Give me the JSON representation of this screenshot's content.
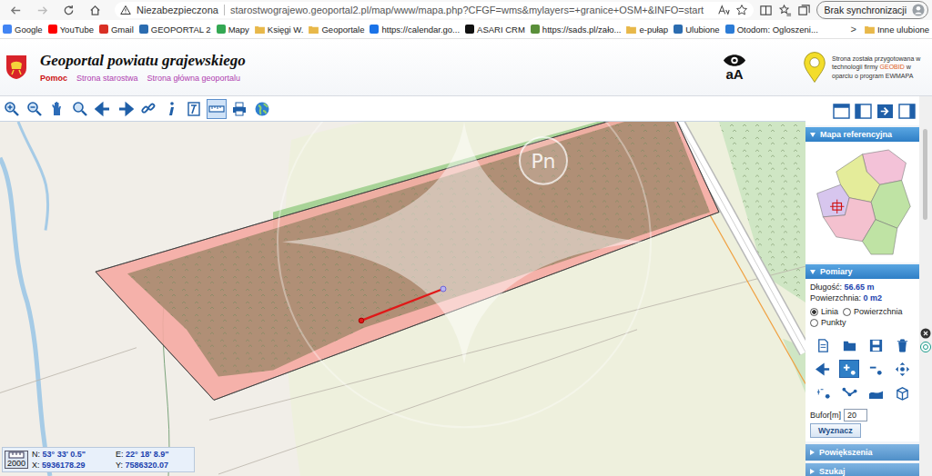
{
  "browser": {
    "security": "Niezabezpieczona",
    "url": "starostwograjewo.geoportal2.pl/map/www/mapa.php?CFGF=wms&mylayers=+granice+OSM+&INFO=start",
    "profile": "Brak synchronizacji"
  },
  "bookmarks": [
    {
      "label": "Google",
      "kind": "site",
      "color": "#4285f4"
    },
    {
      "label": "YouTube",
      "kind": "site",
      "color": "#ff0000"
    },
    {
      "label": "Gmail",
      "kind": "site",
      "color": "#d93025"
    },
    {
      "label": "GEOPORTAL 2",
      "kind": "site",
      "color": "#2b6cb0"
    },
    {
      "label": "Mapy",
      "kind": "site",
      "color": "#34a853"
    },
    {
      "label": "Księgi W.",
      "kind": "folder",
      "color": "#e8b84a"
    },
    {
      "label": "Geoportale",
      "kind": "folder",
      "color": "#e8b84a"
    },
    {
      "label": "https://calendar.go...",
      "kind": "site",
      "color": "#1a73e8"
    },
    {
      "label": "ASARI CRM",
      "kind": "site",
      "color": "#111111"
    },
    {
      "label": "https://sads.pl/zało...",
      "kind": "site",
      "color": "#5a8f3a"
    },
    {
      "label": "e-pułap",
      "kind": "folder",
      "color": "#e8b84a"
    },
    {
      "label": "Ulubione",
      "kind": "site",
      "color": "#2b6cb0"
    },
    {
      "label": "Otodom: Ogloszeni...",
      "kind": "site",
      "color": "#2b7bd6"
    }
  ],
  "bookmarks_more": ">",
  "bookmarks_other": "Inne ulubione",
  "header": {
    "title": "Geoportal powiatu grajewskiego",
    "links": [
      {
        "label": "Pomoc",
        "color": "#cc1111"
      },
      {
        "label": "Strona starostwa",
        "color": "#b040b0"
      },
      {
        "label": "Strona główna geoportalu",
        "color": "#b040b0"
      }
    ],
    "font_toggle": "aA",
    "credit_prefix": "Strona została przygotowana w technologii firmy ",
    "credit_brand": "GEOBID",
    "credit_suffix": " w oparciu o program EWMAPA"
  },
  "tools": [
    {
      "kind": "zoom-in",
      "active": false
    },
    {
      "kind": "zoom-out",
      "active": false
    },
    {
      "kind": "pan",
      "active": false
    },
    {
      "kind": "zoom-box",
      "active": false
    },
    {
      "kind": "back",
      "active": false
    },
    {
      "kind": "forward",
      "active": false
    },
    {
      "kind": "link",
      "active": false
    },
    {
      "kind": "info",
      "active": false
    },
    {
      "kind": "legend",
      "active": false
    },
    {
      "kind": "measure",
      "active": true
    },
    {
      "kind": "print",
      "active": false
    },
    {
      "kind": "globe",
      "active": false
    }
  ],
  "map": {
    "watermark": "Pn"
  },
  "coords": {
    "n_label": "N:",
    "n": "53° 33' 0.5\"",
    "e_label": "E:",
    "e": "22° 18' 8.9\"",
    "x_label": "X:",
    "x": "5936178.29",
    "y_label": "Y:",
    "y": "7586320.07",
    "scale": "2000"
  },
  "panel": {
    "reference_title": "Mapa referencyjna",
    "measure_title": "Pomiary",
    "length_label": "Długość:",
    "length": "56.65 m",
    "area_label": "Powierzchnia:",
    "area": "0 m2",
    "modes": [
      {
        "label": "Linia",
        "selected": true
      },
      {
        "label": "Powierzchnia",
        "selected": false
      },
      {
        "label": "Punkty",
        "selected": false
      }
    ],
    "measure_tools": [
      {
        "kind": "new",
        "active": false
      },
      {
        "kind": "open",
        "active": false
      },
      {
        "kind": "save",
        "active": false
      },
      {
        "kind": "delete",
        "active": false
      },
      {
        "kind": "undo",
        "active": false
      },
      {
        "kind": "add-point",
        "active": true
      },
      {
        "kind": "remove-point",
        "active": false
      },
      {
        "kind": "move",
        "active": false
      },
      {
        "kind": "label",
        "active": false
      },
      {
        "kind": "vertex",
        "active": false
      },
      {
        "kind": "area",
        "active": false
      },
      {
        "kind": "box",
        "active": false
      }
    ],
    "buffer_label": "Bufor[m]",
    "buffer": "20",
    "compute": "Wyznacz",
    "zoom_title": "Powiększenia",
    "search_title": "Szukaj"
  }
}
